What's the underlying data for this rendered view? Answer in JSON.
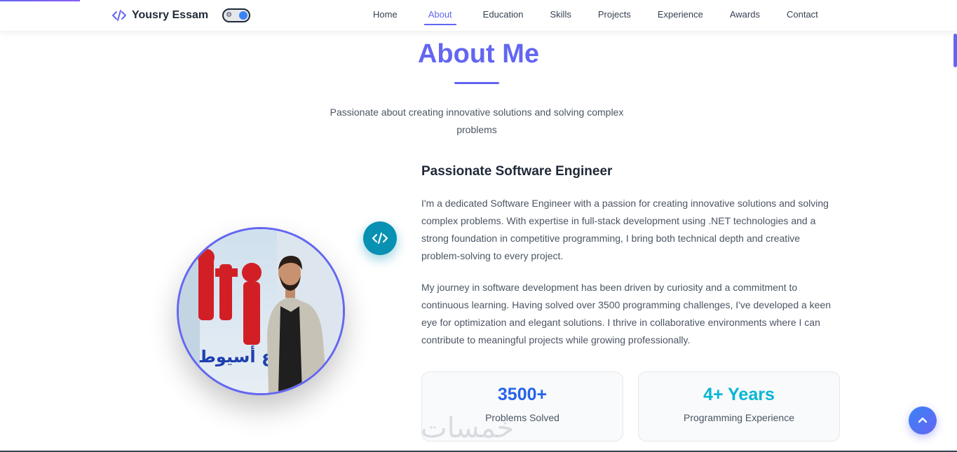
{
  "brand": {
    "name": "Yousry Essam",
    "icon": "code-icon"
  },
  "theme_toggle": {
    "icon": "sun-icon",
    "state": "dark"
  },
  "nav": {
    "items": [
      {
        "label": "Home"
      },
      {
        "label": "About"
      },
      {
        "label": "Education"
      },
      {
        "label": "Skills"
      },
      {
        "label": "Projects"
      },
      {
        "label": "Experience"
      },
      {
        "label": "Awards"
      },
      {
        "label": "Contact"
      }
    ],
    "active": "About"
  },
  "about": {
    "title": "About Me",
    "subtitle": "Passionate about creating innovative solutions and solving complex problems",
    "heading": "Passionate Software Engineer",
    "paragraphs": [
      "I'm a dedicated Software Engineer with a passion for creating innovative solutions and solving complex problems. With expertise in full-stack development using .NET technologies and a strong foundation in competitive programming, I bring both technical depth and creative problem-solving to every project.",
      "My journey in software development has been driven by curiosity and a commitment to continuous learning. Having solved over 3500 programming challenges, I've developed a keen eye for optimization and elegant solutions. I thrive in collaborative environments where I can contribute to meaningful projects while growing professionally."
    ],
    "stats": [
      {
        "value": "3500+",
        "label": "Problems Solved"
      },
      {
        "value": "4+ Years",
        "label": "Programming Experience"
      }
    ],
    "badge_icon": "code-icon"
  },
  "photo": {
    "sign_text": "iti",
    "arabic_text": "فرع أسيوط"
  },
  "watermark": "خمسات",
  "scroll_top_icon": "chevron-up-icon",
  "colors": {
    "accent": "#6366f1",
    "stat_primary": "#2563eb",
    "stat_secondary": "#06b6d4",
    "badge": "#0891b2"
  }
}
